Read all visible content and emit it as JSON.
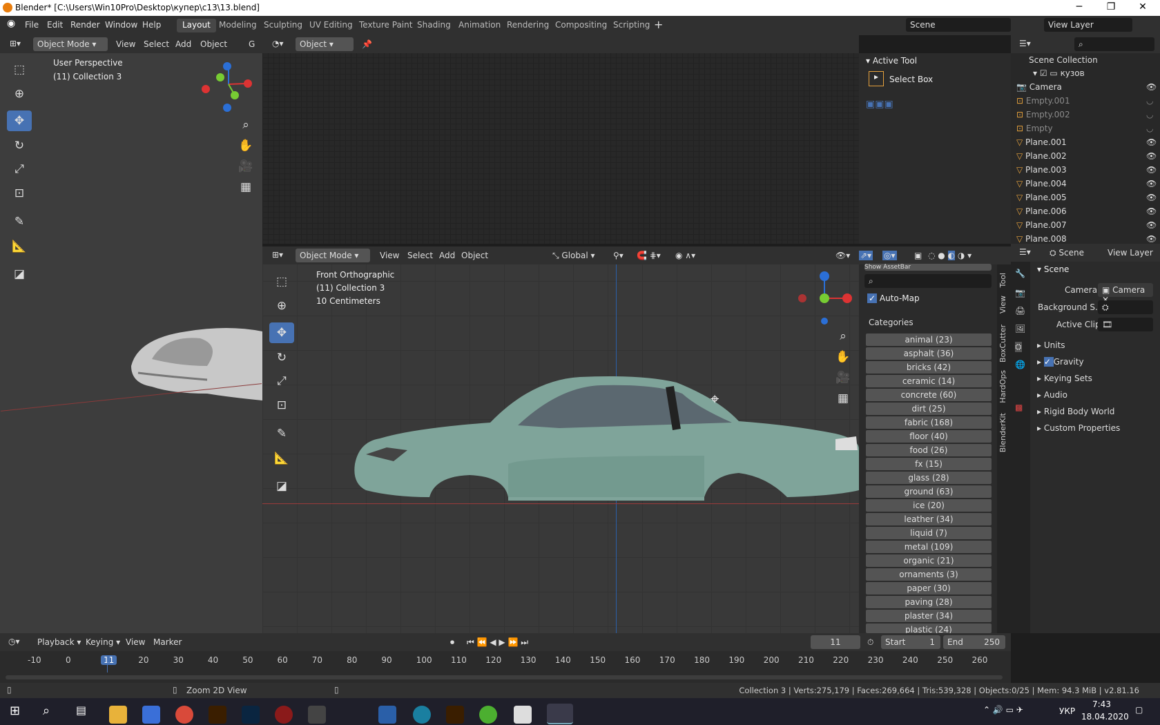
{
  "window": {
    "title": "Blender* [C:\\Users\\Win10Pro\\Desktop\\купер\\c13\\13.blend]",
    "minimize": "─",
    "maximize": "❐",
    "close": "✕"
  },
  "menu": [
    "File",
    "Edit",
    "Render",
    "Window",
    "Help"
  ],
  "workspaces": [
    "Layout",
    "Modeling",
    "Sculpting",
    "UV Editing",
    "Texture Paint",
    "Shading",
    "Animation",
    "Rendering",
    "Compositing",
    "Scripting"
  ],
  "scene": {
    "label": "Scene",
    "view_layer": "View Layer"
  },
  "left_view": {
    "mode": "Object Mode",
    "menus": [
      "View",
      "Select",
      "Add",
      "Object"
    ],
    "g": "G",
    "overlay1": "User Perspective",
    "overlay2": "(11) Collection 3"
  },
  "top_editor": {
    "mode": "Object"
  },
  "active_tool": {
    "title": "Active Tool",
    "tool": "Select Box"
  },
  "outliner": {
    "title": "Scene Collection",
    "collection": "кузов",
    "items": [
      {
        "name": "Camera",
        "dim": false
      },
      {
        "name": "Empty.001",
        "dim": true
      },
      {
        "name": "Empty.002",
        "dim": true
      },
      {
        "name": "Empty",
        "dim": true
      },
      {
        "name": "Plane.001",
        "dim": false
      },
      {
        "name": "Plane.002",
        "dim": false
      },
      {
        "name": "Plane.003",
        "dim": false
      },
      {
        "name": "Plane.004",
        "dim": false
      },
      {
        "name": "Plane.005",
        "dim": false
      },
      {
        "name": "Plane.006",
        "dim": false
      },
      {
        "name": "Plane.007",
        "dim": false
      },
      {
        "name": "Plane.008",
        "dim": false
      }
    ]
  },
  "main_view": {
    "mode": "Object Mode",
    "menus": [
      "View",
      "Select",
      "Add",
      "Object"
    ],
    "orientation": "Global",
    "overlay1": "Front Orthographic",
    "overlay2": "(11) Collection 3",
    "overlay3": "10 Centimeters"
  },
  "asset_panel": {
    "top": "Show AssetBar",
    "auto_map": "Auto-Map",
    "categories_label": "Categories",
    "categories": [
      "animal (23)",
      "asphalt (36)",
      "bricks (42)",
      "ceramic (14)",
      "concrete (60)",
      "dirt (25)",
      "fabric (168)",
      "floor (40)",
      "food (26)",
      "fx (15)",
      "glass (28)",
      "ground (63)",
      "ice (20)",
      "leather (34)",
      "liquid (7)",
      "metal (109)",
      "organic (21)",
      "ornaments (3)",
      "paper (30)",
      "paving (28)",
      "plaster (34)",
      "plastic (24)"
    ],
    "tabs": [
      "Tool",
      "View",
      "BoxCutter",
      "HardOps",
      "BlenderKit"
    ]
  },
  "properties": {
    "header": "Scene",
    "view_layer": "View Layer",
    "section": "Scene",
    "camera_label": "Camera",
    "camera_value": "Camera",
    "bg_label": "Background S..",
    "clip_label": "Active Clip",
    "panels": [
      "Units",
      "Gravity",
      "Keying Sets",
      "Audio",
      "Rigid Body World",
      "Custom Properties"
    ]
  },
  "timeline": {
    "menus": [
      "Playback",
      "Keying",
      "View",
      "Marker"
    ],
    "current": "11",
    "start_label": "Start",
    "start": "1",
    "end_label": "End",
    "end": "250",
    "ticks": [
      "-10",
      "0",
      "11",
      "20",
      "30",
      "40",
      "50",
      "60",
      "70",
      "80",
      "90",
      "100",
      "110",
      "120",
      "130",
      "140",
      "150",
      "160",
      "170",
      "180",
      "190",
      "200",
      "210",
      "220",
      "230",
      "240",
      "250",
      "260"
    ]
  },
  "statusbar": {
    "hint": "Zoom 2D View",
    "stats": "Collection 3 | Verts:275,179 | Faces:269,664 | Tris:539,328 | Objects:0/25 | Mem: 94.3 MiB | v2.81.16"
  },
  "taskbar": {
    "lang": "УКР",
    "time": "7:43",
    "date": "18.04.2020"
  }
}
